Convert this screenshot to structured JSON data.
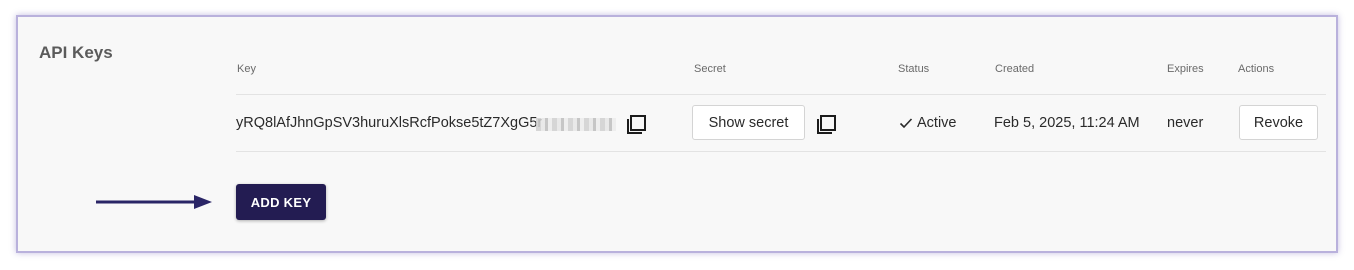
{
  "section": {
    "title": "API Keys"
  },
  "table": {
    "headers": {
      "key": "Key",
      "secret": "Secret",
      "status": "Status",
      "created": "Created",
      "expires": "Expires",
      "actions": "Actions"
    },
    "rows": [
      {
        "key": "yRQ8lAfJhnGpSV3huruXlsRcfPokse5tZ7XgG5r",
        "show_secret_label": "Show secret",
        "status": "Active",
        "created": "Feb 5, 2025, 11:24 AM",
        "expires": "never",
        "revoke_label": "Revoke"
      }
    ]
  },
  "add_key_label": "ADD KEY",
  "colors": {
    "primary": "#231c52",
    "panel_border": "#b9b1dc",
    "background": "#f8f8f8"
  },
  "icons": [
    "copy-icon",
    "check-icon",
    "arrow-right-icon"
  ]
}
